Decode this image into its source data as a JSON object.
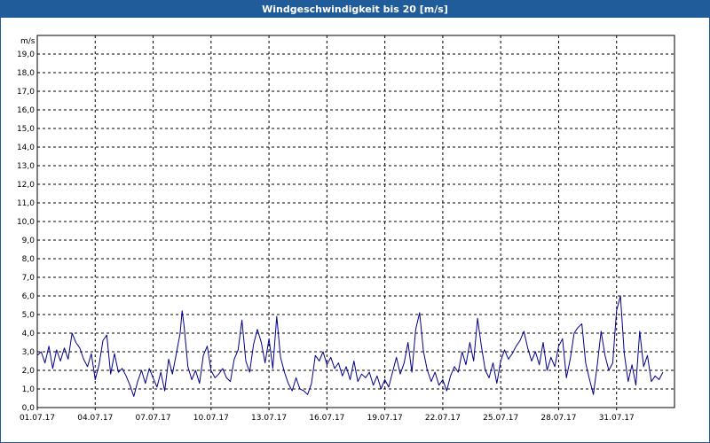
{
  "title": "Windgeschwindigkeit bis 20 [m/s]",
  "chart_data": {
    "type": "line",
    "ylabel": "m/s",
    "ylim": [
      0,
      20
    ],
    "xlim": [
      0,
      33
    ],
    "y_ticks": [
      "0,0",
      "1,0",
      "2,0",
      "3,0",
      "4,0",
      "5,0",
      "6,0",
      "7,0",
      "8,0",
      "9,0",
      "10,0",
      "11,0",
      "12,0",
      "13,0",
      "14,0",
      "15,0",
      "16,0",
      "17,0",
      "18,0",
      "19,0"
    ],
    "x_ticks": [
      {
        "pos": 0,
        "label": "01.07.17"
      },
      {
        "pos": 3,
        "label": "04.07.17"
      },
      {
        "pos": 6,
        "label": "07.07.17"
      },
      {
        "pos": 9,
        "label": "10.07.17"
      },
      {
        "pos": 12,
        "label": "13.07.17"
      },
      {
        "pos": 15,
        "label": "16.07.17"
      },
      {
        "pos": 18,
        "label": "19.07.17"
      },
      {
        "pos": 21,
        "label": "22.07.17"
      },
      {
        "pos": 24,
        "label": "25.07.17"
      },
      {
        "pos": 27,
        "label": "28.07.17"
      },
      {
        "pos": 30,
        "label": "31.07.17"
      }
    ],
    "grid": true,
    "series": [
      {
        "color": "#00008b",
        "points": [
          [
            0.0,
            2.8
          ],
          [
            0.2,
            3.0
          ],
          [
            0.4,
            2.4
          ],
          [
            0.6,
            3.3
          ],
          [
            0.8,
            2.1
          ],
          [
            1.0,
            3.1
          ],
          [
            1.2,
            2.5
          ],
          [
            1.4,
            3.2
          ],
          [
            1.6,
            2.6
          ],
          [
            1.8,
            4.0
          ],
          [
            2.0,
            3.5
          ],
          [
            2.2,
            3.2
          ],
          [
            2.4,
            2.6
          ],
          [
            2.6,
            2.2
          ],
          [
            2.8,
            2.9
          ],
          [
            3.0,
            1.5
          ],
          [
            3.2,
            2.3
          ],
          [
            3.4,
            3.6
          ],
          [
            3.6,
            3.9
          ],
          [
            3.8,
            1.8
          ],
          [
            4.0,
            2.9
          ],
          [
            4.2,
            1.9
          ],
          [
            4.4,
            2.1
          ],
          [
            4.6,
            1.7
          ],
          [
            4.8,
            1.2
          ],
          [
            5.0,
            0.6
          ],
          [
            5.2,
            1.4
          ],
          [
            5.4,
            2.0
          ],
          [
            5.6,
            1.3
          ],
          [
            5.8,
            2.1
          ],
          [
            6.0,
            1.6
          ],
          [
            6.2,
            1.1
          ],
          [
            6.4,
            1.9
          ],
          [
            6.6,
            0.9
          ],
          [
            6.8,
            2.6
          ],
          [
            7.0,
            1.8
          ],
          [
            7.2,
            2.9
          ],
          [
            7.4,
            4.0
          ],
          [
            7.5,
            5.2
          ],
          [
            7.6,
            4.4
          ],
          [
            7.8,
            2.2
          ],
          [
            8.0,
            1.5
          ],
          [
            8.2,
            2.0
          ],
          [
            8.4,
            1.3
          ],
          [
            8.6,
            2.8
          ],
          [
            8.8,
            3.3
          ],
          [
            9.0,
            2.0
          ],
          [
            9.2,
            1.6
          ],
          [
            9.4,
            1.8
          ],
          [
            9.6,
            2.1
          ],
          [
            9.8,
            1.6
          ],
          [
            10.0,
            1.4
          ],
          [
            10.2,
            2.6
          ],
          [
            10.4,
            3.1
          ],
          [
            10.6,
            4.7
          ],
          [
            10.8,
            2.5
          ],
          [
            11.0,
            1.9
          ],
          [
            11.2,
            3.4
          ],
          [
            11.4,
            4.2
          ],
          [
            11.6,
            3.5
          ],
          [
            11.8,
            2.4
          ],
          [
            12.0,
            3.7
          ],
          [
            12.2,
            2.1
          ],
          [
            12.4,
            4.9
          ],
          [
            12.6,
            2.7
          ],
          [
            12.8,
            1.9
          ],
          [
            13.0,
            1.3
          ],
          [
            13.2,
            0.9
          ],
          [
            13.4,
            1.6
          ],
          [
            13.6,
            1.0
          ],
          [
            13.8,
            0.9
          ],
          [
            14.0,
            0.7
          ],
          [
            14.2,
            1.3
          ],
          [
            14.4,
            2.8
          ],
          [
            14.6,
            2.5
          ],
          [
            14.8,
            3.0
          ],
          [
            15.0,
            2.3
          ],
          [
            15.2,
            2.7
          ],
          [
            15.4,
            2.1
          ],
          [
            15.6,
            2.4
          ],
          [
            15.8,
            1.7
          ],
          [
            16.0,
            2.2
          ],
          [
            16.2,
            1.5
          ],
          [
            16.4,
            2.5
          ],
          [
            16.6,
            1.4
          ],
          [
            16.8,
            1.8
          ],
          [
            17.0,
            1.6
          ],
          [
            17.2,
            1.9
          ],
          [
            17.4,
            1.2
          ],
          [
            17.6,
            1.7
          ],
          [
            17.8,
            1.0
          ],
          [
            18.0,
            1.5
          ],
          [
            18.2,
            1.1
          ],
          [
            18.4,
            1.9
          ],
          [
            18.6,
            2.7
          ],
          [
            18.8,
            1.8
          ],
          [
            19.0,
            2.4
          ],
          [
            19.2,
            3.5
          ],
          [
            19.4,
            1.9
          ],
          [
            19.6,
            4.2
          ],
          [
            19.8,
            5.1
          ],
          [
            20.0,
            3.0
          ],
          [
            20.2,
            2.0
          ],
          [
            20.4,
            1.4
          ],
          [
            20.6,
            1.9
          ],
          [
            20.8,
            1.2
          ],
          [
            21.0,
            1.5
          ],
          [
            21.2,
            0.9
          ],
          [
            21.4,
            1.7
          ],
          [
            21.6,
            2.2
          ],
          [
            21.8,
            1.9
          ],
          [
            22.0,
            3.0
          ],
          [
            22.2,
            2.3
          ],
          [
            22.4,
            3.5
          ],
          [
            22.6,
            2.5
          ],
          [
            22.8,
            4.8
          ],
          [
            23.0,
            3.3
          ],
          [
            23.2,
            2.0
          ],
          [
            23.4,
            1.6
          ],
          [
            23.6,
            2.4
          ],
          [
            23.8,
            1.3
          ],
          [
            24.0,
            2.5
          ],
          [
            24.2,
            3.1
          ],
          [
            24.4,
            2.6
          ],
          [
            24.6,
            2.9
          ],
          [
            24.8,
            3.3
          ],
          [
            25.0,
            3.6
          ],
          [
            25.2,
            4.1
          ],
          [
            25.4,
            3.2
          ],
          [
            25.6,
            2.5
          ],
          [
            25.8,
            3.0
          ],
          [
            26.0,
            2.3
          ],
          [
            26.2,
            3.5
          ],
          [
            26.4,
            2.0
          ],
          [
            26.6,
            2.7
          ],
          [
            26.8,
            2.2
          ],
          [
            27.0,
            3.3
          ],
          [
            27.2,
            3.7
          ],
          [
            27.4,
            1.6
          ],
          [
            27.6,
            2.6
          ],
          [
            27.8,
            4.0
          ],
          [
            28.0,
            4.3
          ],
          [
            28.2,
            4.5
          ],
          [
            28.4,
            2.4
          ],
          [
            28.6,
            1.5
          ],
          [
            28.8,
            0.7
          ],
          [
            29.0,
            2.3
          ],
          [
            29.2,
            4.1
          ],
          [
            29.4,
            2.8
          ],
          [
            29.6,
            2.0
          ],
          [
            29.8,
            2.4
          ],
          [
            30.0,
            5.2
          ],
          [
            30.2,
            6.0
          ],
          [
            30.4,
            2.9
          ],
          [
            30.6,
            1.4
          ],
          [
            30.8,
            2.3
          ],
          [
            31.0,
            1.2
          ],
          [
            31.2,
            4.1
          ],
          [
            31.4,
            2.2
          ],
          [
            31.6,
            2.8
          ],
          [
            31.8,
            1.4
          ],
          [
            32.0,
            1.7
          ],
          [
            32.2,
            1.5
          ],
          [
            32.4,
            1.9
          ]
        ]
      }
    ]
  }
}
